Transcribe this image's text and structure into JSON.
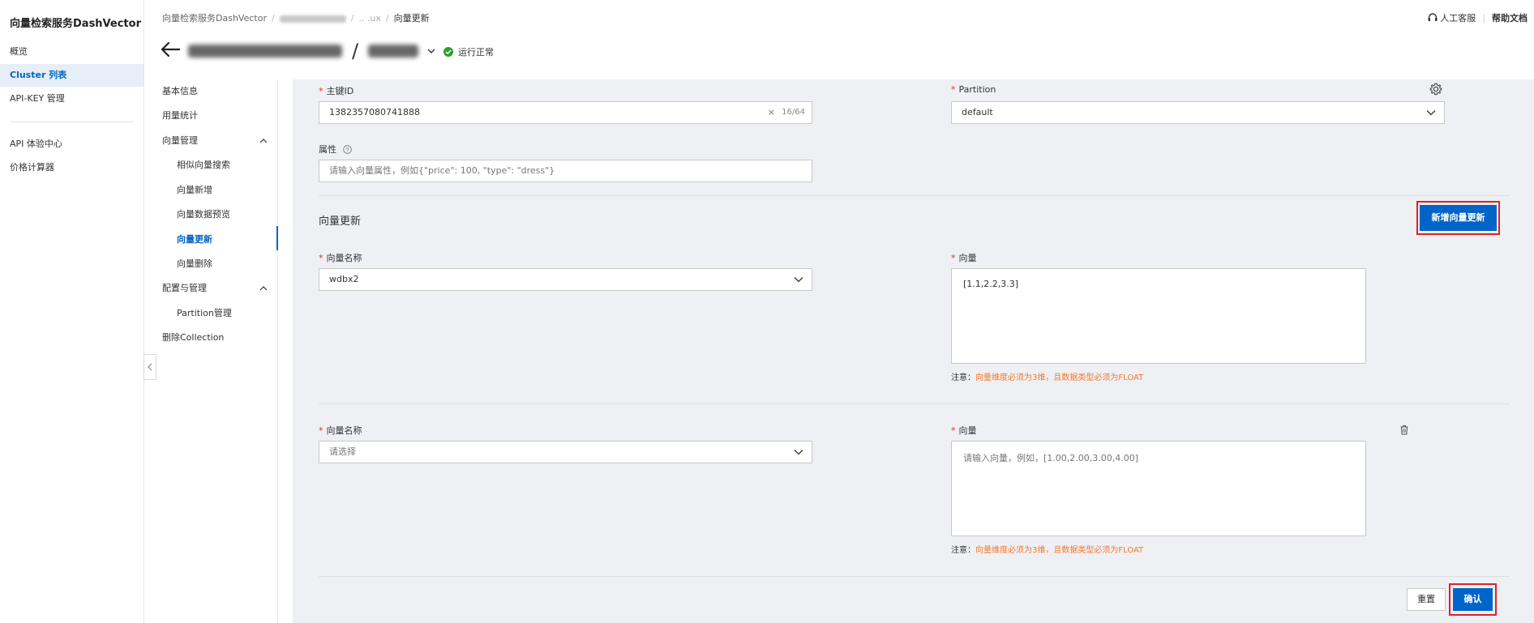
{
  "app": {
    "title": "向量检索服务DashVector"
  },
  "sidebar": {
    "items": [
      {
        "label": "概览"
      },
      {
        "label": "Cluster 列表"
      },
      {
        "label": "API-KEY 管理"
      },
      {
        "label": "API 体验中心"
      },
      {
        "label": "价格计算器"
      }
    ]
  },
  "breadcrumb": {
    "root": "向量检索服务DashVector",
    "cluster_partial": ".. .ux",
    "current": "向量更新"
  },
  "top_links": {
    "support": "人工客服",
    "docs": "帮助文档"
  },
  "header": {
    "status": "运行正常",
    "status_color": "#2ca02c"
  },
  "subnav": {
    "basic_info": "基本信息",
    "usage": "用量统计",
    "vector_mgmt": "向量管理",
    "similar_search": "相似向量搜索",
    "vector_add": "向量新增",
    "data_preview": "向量数据预览",
    "vector_update": "向量更新",
    "vector_delete": "向量删除",
    "config_mgmt": "配置与管理",
    "partition_mgmt": "Partition管理",
    "delete_collection": "删除Collection"
  },
  "form": {
    "primary_key": {
      "label": "主键ID",
      "value": "1382357080741888",
      "counter": "16/64",
      "clear": "×"
    },
    "partition": {
      "label": "Partition",
      "value": "default"
    },
    "attributes": {
      "label": "属性",
      "placeholder": "请输入向量属性，例如{\"price\": 100, \"type\": \"dress\"}"
    },
    "vector_section": {
      "title": "向量更新",
      "add_button": "新增向量更新"
    },
    "rows": [
      {
        "name_label": "向量名称",
        "name_value": "wdbx2",
        "vector_label": "向量",
        "vector_value": "[1.1,2.2,3.3]",
        "note_prefix": "注意：",
        "note_warn": "向量维度必须为3维，且数据类型必须为FLOAT"
      },
      {
        "name_label": "向量名称",
        "name_placeholder": "请选择",
        "vector_label": "向量",
        "vector_placeholder": "请输入向量，例如，[1.00,2.00,3.00,4.00]",
        "note_prefix": "注意：",
        "note_warn": "向量维度必须为3维，且数据类型必须为FLOAT"
      }
    ],
    "reset_button": "重置",
    "confirm_button": "确认"
  },
  "colors": {
    "accent": "#0064c8",
    "warning": "#f5782d",
    "highlight_box": "#e02020"
  }
}
